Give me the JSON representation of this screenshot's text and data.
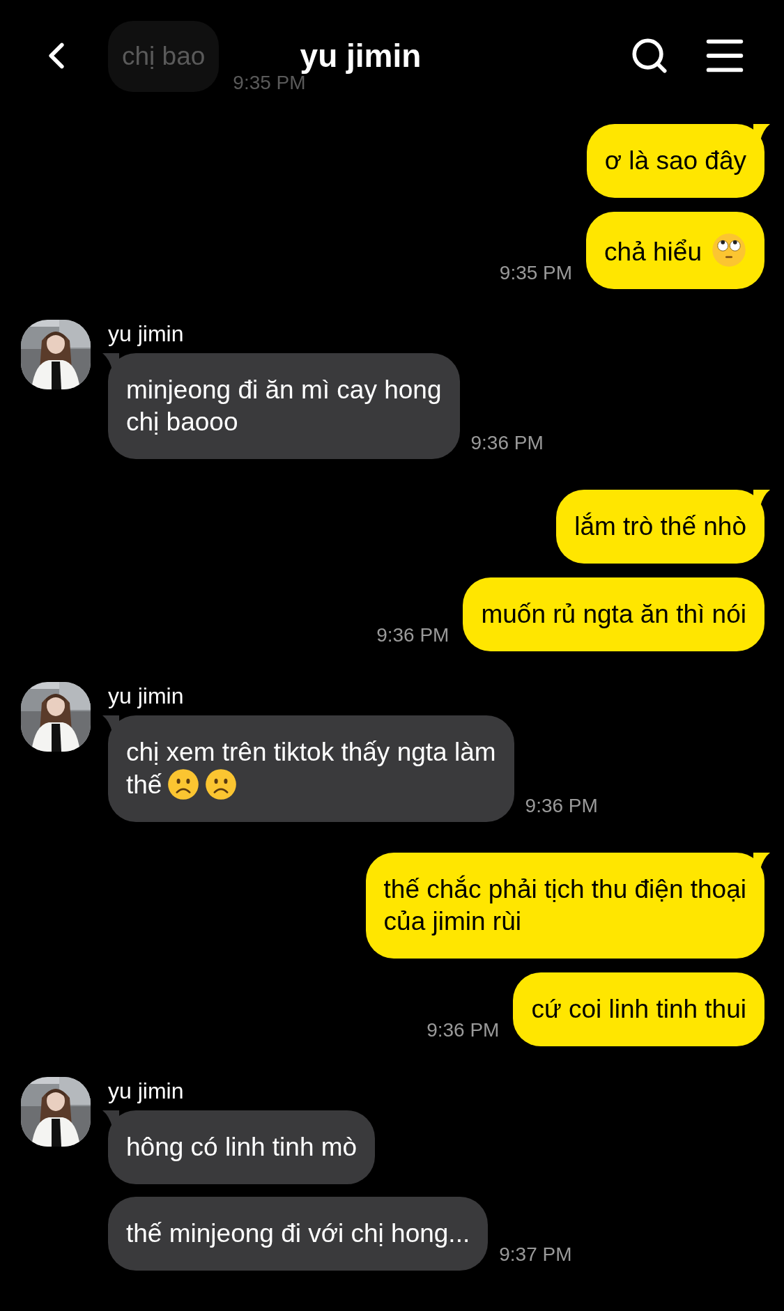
{
  "header": {
    "title": "yu jimin"
  },
  "faded_message": {
    "text": "chị bao",
    "time": "9:35 PM"
  },
  "groups": [
    {
      "kind": "outgoing",
      "messages": [
        {
          "text": "ơ là sao đây"
        },
        {
          "text": "chả hiểu",
          "emoji": [
            {
              "kind": "eye-roll"
            }
          ]
        }
      ],
      "time": "9:35 PM"
    },
    {
      "kind": "incoming",
      "name": "yu jimin",
      "messages": [
        {
          "text": "minjeong đi ăn mì cay hong\nchị baooo"
        }
      ],
      "time": "9:36 PM"
    },
    {
      "kind": "outgoing",
      "messages": [
        {
          "text": "lắm trò thế nhò"
        },
        {
          "text": "muốn rủ ngta ăn thì nói"
        }
      ],
      "time": "9:36 PM"
    },
    {
      "kind": "incoming",
      "name": "yu jimin",
      "messages": [
        {
          "text": "chị xem trên tiktok thấy ngta làm\nthế",
          "emoji": [
            {
              "kind": "frown"
            },
            {
              "kind": "frown"
            }
          ]
        }
      ],
      "time": "9:36 PM"
    },
    {
      "kind": "outgoing",
      "messages": [
        {
          "text": "thế chắc phải tịch thu điện thoại\ncủa jimin rùi"
        },
        {
          "text": "cứ coi linh tinh thui"
        }
      ],
      "time": "9:36 PM"
    },
    {
      "kind": "incoming",
      "name": "yu jimin",
      "messages": [
        {
          "text": "hông có linh tinh mò"
        },
        {
          "text": "thế minjeong đi với chị hong..."
        }
      ],
      "time": "9:37 PM"
    }
  ]
}
